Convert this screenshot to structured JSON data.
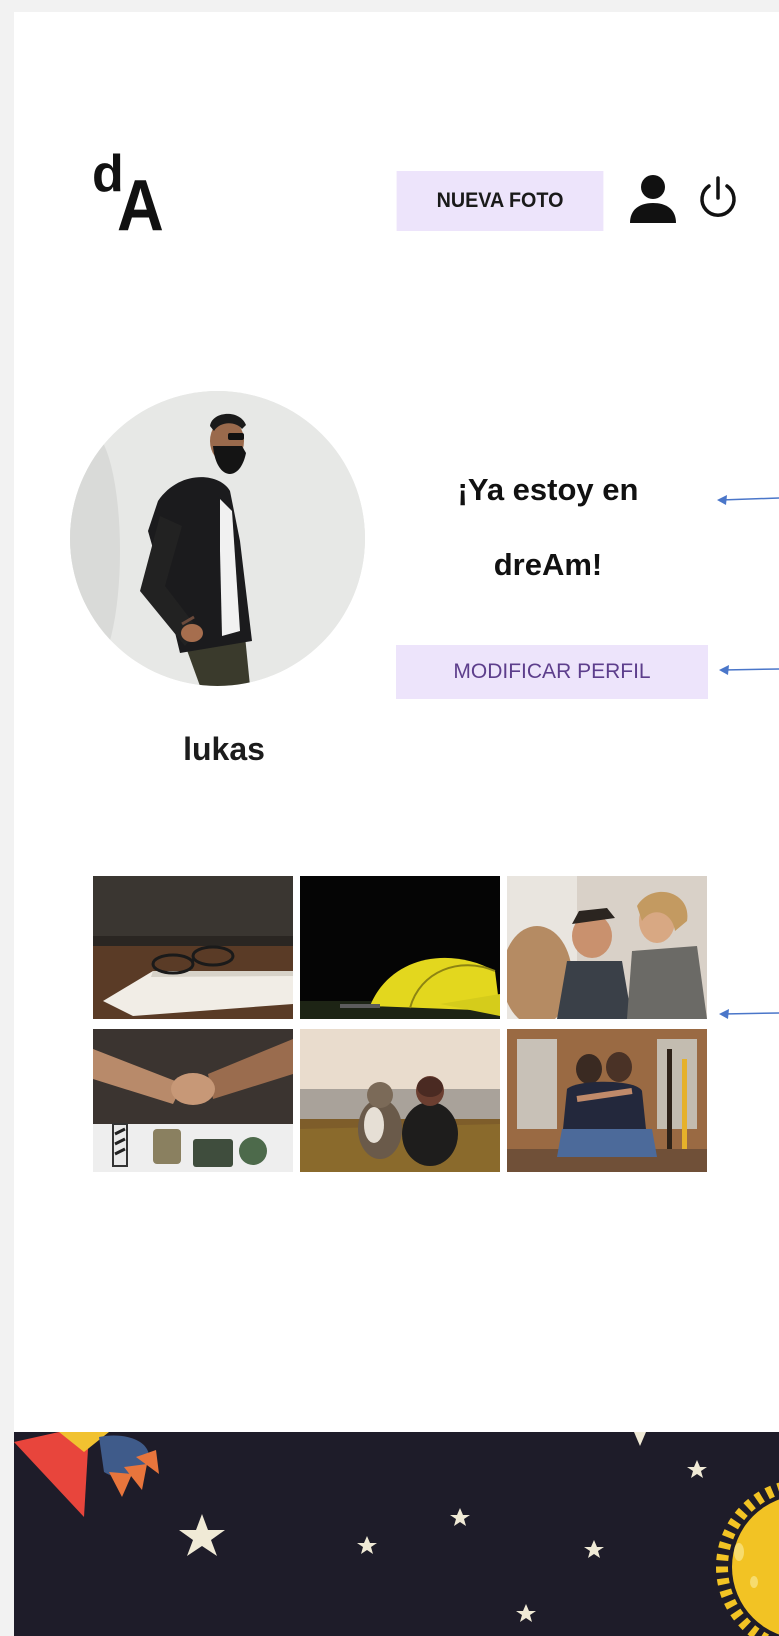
{
  "header": {
    "logo_small": "d",
    "logo_large": "A",
    "new_photo_label": "NUEVA FOTO",
    "icons": [
      "user-icon",
      "power-icon"
    ]
  },
  "profile": {
    "username": "lukas",
    "tagline_line1": "¡Ya estoy en",
    "tagline_line2": "dreAm!",
    "edit_label": "MODIFICAR PERFIL"
  },
  "gallery": {
    "photos": [
      "book-glasses-photo",
      "tent-night-photo",
      "friends-laughing-photo",
      "fists-bump-photo",
      "dog-person-lake-photo",
      "couple-hug-photo"
    ]
  },
  "colors": {
    "button_bg": "#ede4fb",
    "button_text_accent": "#5d3e8c",
    "arrow": "#4a76c9",
    "footer_bg": "#1e1c29",
    "sun": "#f2c324"
  }
}
